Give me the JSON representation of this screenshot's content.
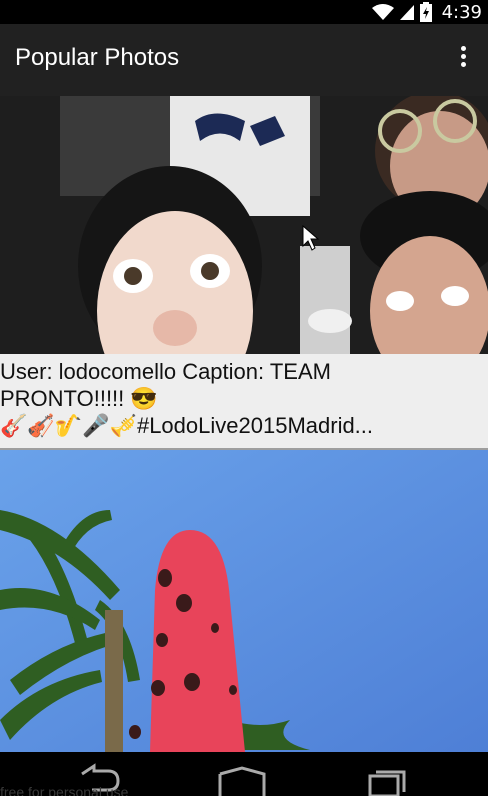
{
  "status_bar": {
    "time": "4:39"
  },
  "app_bar": {
    "title": "Popular Photos"
  },
  "feed": [
    {
      "caption_line1": "User: lodocomello Caption: TEAM",
      "caption_line2": "PRONTO!!!!! 😎",
      "caption_line3": "🎸🎻🎷🎤🎺#LodoLive2015Madrid..."
    }
  ],
  "watermark": "free for personal use",
  "icons": [
    "wifi-icon",
    "signal-icon",
    "battery-icon",
    "overflow-menu-icon",
    "back-icon",
    "home-icon",
    "recents-icon"
  ]
}
